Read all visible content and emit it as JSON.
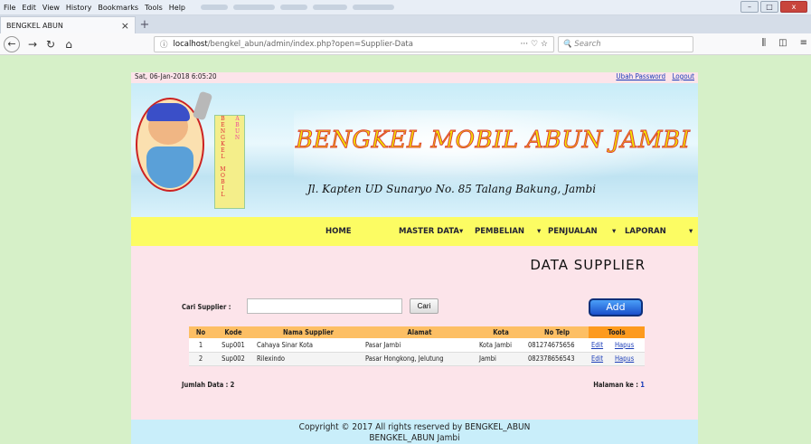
{
  "browser": {
    "menus": [
      {
        "label": "File"
      },
      {
        "label": "Edit"
      },
      {
        "label": "View"
      },
      {
        "label": "History"
      },
      {
        "label": "Bookmarks"
      },
      {
        "label": "Tools"
      },
      {
        "label": "Help"
      }
    ],
    "tab_title": "BENGKEL ABUN",
    "tab_close": "×",
    "new_tab": "+",
    "url_host": "localhost",
    "url_path": "/bengkel_abun/admin/index.php?open=Supplier-Data",
    "url_actions": "··· ♡ ☆",
    "search_placeholder": "Search",
    "window_controls": {
      "minimize": "–",
      "maximize": "□",
      "close": "x"
    }
  },
  "page": {
    "datetime": "Sat, 06-Jan-2018 6:05:20",
    "link_password": "Ubah Password",
    "link_logout": "Logout",
    "banner": {
      "title": "BENGKEL MOBIL ABUN JAMBI",
      "address": "Jl. Kapten UD Sunaryo No. 85 Talang Bakung, Jambi",
      "sign_col1": "BENGKEL MOBIL",
      "sign_col2": "ABUN"
    },
    "menu": {
      "home": "HOME",
      "master": "MASTER DATA",
      "pembelian": "PEMBELIAN",
      "penjualan": "PENJUALAN",
      "laporan": "LAPORAN",
      "caret": "▾"
    },
    "section_title": "DATA SUPPLIER",
    "search": {
      "label": "Cari Supplier :",
      "value": "",
      "button": "Cari"
    },
    "add_button": "Add",
    "table": {
      "headers": {
        "no": "No",
        "kode": "Kode",
        "nama": "Nama Supplier",
        "alamat": "Alamat",
        "kota": "Kota",
        "telp": "No Telp",
        "tools": "Tools"
      },
      "rows": [
        {
          "no": "1",
          "kode": "Sup001",
          "nama": "Cahaya Sinar Kota",
          "alamat": "Pasar Jambi",
          "kota": "Kota Jambi",
          "telp": "081274675656",
          "edit": "Edit",
          "hapus": "Hapus"
        },
        {
          "no": "2",
          "kode": "Sup002",
          "nama": "Rilexindo",
          "alamat": "Pasar Hongkong, Jelutung",
          "kota": "Jambi",
          "telp": "082378656543",
          "edit": "Edit",
          "hapus": "Hapus"
        }
      ]
    },
    "jumlah_label": "Jumlah Data : 2",
    "halaman_label": "Halaman ke :",
    "halaman_page": "1",
    "copyright_line1": "Copyright © 2017 All rights reserved by BENGKEL_ABUN",
    "copyright_line2": "BENGKEL_ABUN Jambi"
  }
}
